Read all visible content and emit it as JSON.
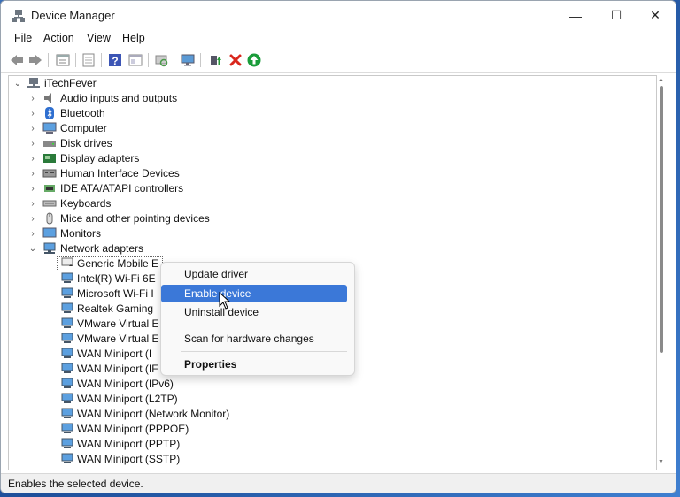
{
  "window": {
    "title": "Device Manager",
    "controls": {
      "minimize": "—",
      "maximize": "☐",
      "close": "✕"
    }
  },
  "menubar": [
    "File",
    "Action",
    "View",
    "Help"
  ],
  "toolbar": {
    "icons": [
      "back-icon",
      "forward-icon",
      "properties-icon",
      "show-hide-icon",
      "help-icon",
      "console-icon",
      "scan-icon",
      "monitor-icon",
      "update-driver-icon",
      "uninstall-icon",
      "enable-icon"
    ],
    "accent": {
      "uninstall": "#d9261c",
      "enable": "#1a9c3a"
    }
  },
  "tree": {
    "root": "iTechFever",
    "categories": [
      {
        "label": "Audio inputs and outputs",
        "icon": "speaker-icon"
      },
      {
        "label": "Bluetooth",
        "icon": "bluetooth-icon"
      },
      {
        "label": "Computer",
        "icon": "computer-icon"
      },
      {
        "label": "Disk drives",
        "icon": "disk-icon"
      },
      {
        "label": "Display adapters",
        "icon": "display-adapter-icon"
      },
      {
        "label": "Human Interface Devices",
        "icon": "hid-icon"
      },
      {
        "label": "IDE ATA/ATAPI controllers",
        "icon": "ide-icon"
      },
      {
        "label": "Keyboards",
        "icon": "keyboard-icon"
      },
      {
        "label": "Mice and other pointing devices",
        "icon": "mouse-icon"
      },
      {
        "label": "Monitors",
        "icon": "monitor-icon"
      },
      {
        "label": "Network adapters",
        "icon": "network-icon",
        "expanded": true
      }
    ],
    "network_children": [
      "Generic Mobile E",
      "Intel(R) Wi-Fi 6E",
      "Microsoft Wi-Fi I",
      "Realtek Gaming",
      "VMware Virtual E",
      "VMware Virtual E",
      "WAN Miniport (I",
      "WAN Miniport (IF",
      "WAN Miniport (IPv6)",
      "WAN Miniport (L2TP)",
      "WAN Miniport (Network Monitor)",
      "WAN Miniport (PPPOE)",
      "WAN Miniport (PPTP)",
      "WAN Miniport (SSTP)"
    ]
  },
  "context_menu": {
    "items": [
      "Update driver",
      "Enable device",
      "Uninstall device",
      "Scan for hardware changes",
      "Properties"
    ],
    "highlighted": "Enable device",
    "highlight_color": "#3b78d8"
  },
  "statusbar": {
    "text": "Enables the selected device."
  }
}
